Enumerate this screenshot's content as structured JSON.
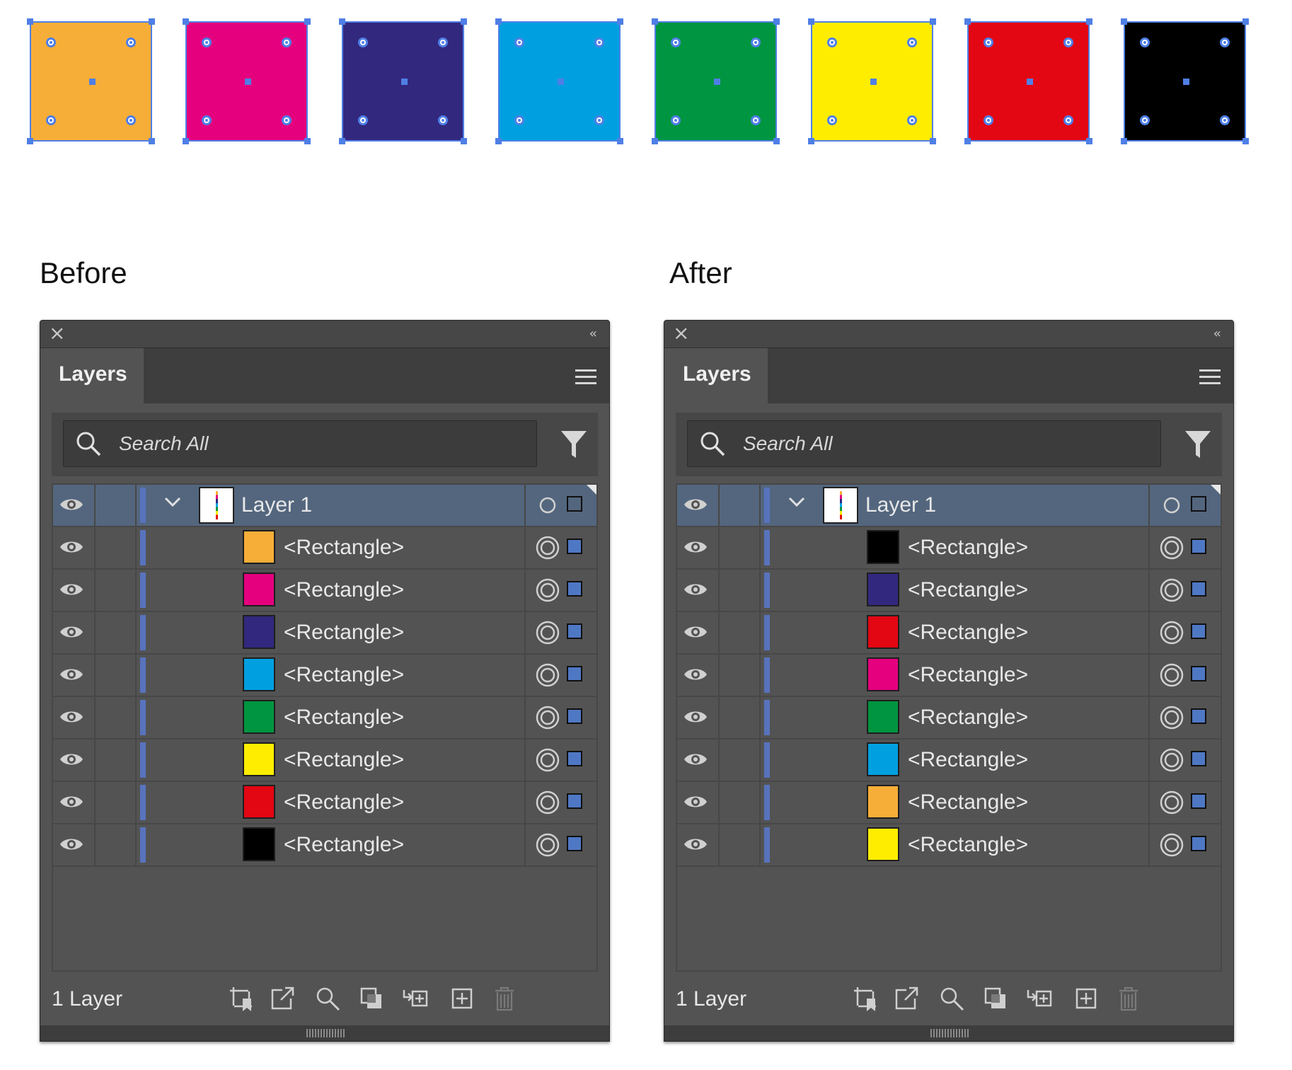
{
  "colors": {
    "orange": "#f7ae38",
    "magenta": "#e5007e",
    "indigo": "#32287e",
    "cyan": "#00a0e0",
    "green": "#009540",
    "yellow": "#ffed00",
    "red": "#e30613",
    "black": "#000000",
    "selection": "#4f7fe6",
    "layer_color_bar": "#5873bd"
  },
  "canvas_swatches": [
    "orange",
    "magenta",
    "indigo",
    "cyan",
    "green",
    "yellow",
    "red",
    "black"
  ],
  "before": {
    "heading": "Before",
    "panel": {
      "tab_label": "Layers",
      "search_placeholder": "Search All",
      "layer_name": "Layer 1",
      "footer_count": "1 Layer",
      "rows": [
        {
          "name": "<Rectangle>",
          "color": "orange"
        },
        {
          "name": "<Rectangle>",
          "color": "magenta"
        },
        {
          "name": "<Rectangle>",
          "color": "indigo"
        },
        {
          "name": "<Rectangle>",
          "color": "cyan"
        },
        {
          "name": "<Rectangle>",
          "color": "green"
        },
        {
          "name": "<Rectangle>",
          "color": "yellow"
        },
        {
          "name": "<Rectangle>",
          "color": "red"
        },
        {
          "name": "<Rectangle>",
          "color": "black"
        }
      ]
    }
  },
  "after": {
    "heading": "After",
    "panel": {
      "tab_label": "Layers",
      "search_placeholder": "Search All",
      "layer_name": "Layer 1",
      "footer_count": "1 Layer",
      "rows": [
        {
          "name": "<Rectangle>",
          "color": "black"
        },
        {
          "name": "<Rectangle>",
          "color": "indigo"
        },
        {
          "name": "<Rectangle>",
          "color": "red"
        },
        {
          "name": "<Rectangle>",
          "color": "magenta"
        },
        {
          "name": "<Rectangle>",
          "color": "green"
        },
        {
          "name": "<Rectangle>",
          "color": "cyan"
        },
        {
          "name": "<Rectangle>",
          "color": "orange"
        },
        {
          "name": "<Rectangle>",
          "color": "yellow"
        }
      ]
    }
  },
  "icons": {
    "visibility": "eye-icon",
    "expand": "chevron-down-icon",
    "target": "target-icon",
    "close": "close-icon",
    "collapse": "collapse-panel-icon",
    "menu": "panel-menu-icon",
    "search": "search-icon",
    "filter": "filter-icon",
    "footer": [
      "collect-for-export-icon",
      "export-icon",
      "locate-object-icon",
      "make-clipping-mask-icon",
      "create-new-sublayer-icon",
      "create-new-layer-icon",
      "delete-icon"
    ]
  }
}
